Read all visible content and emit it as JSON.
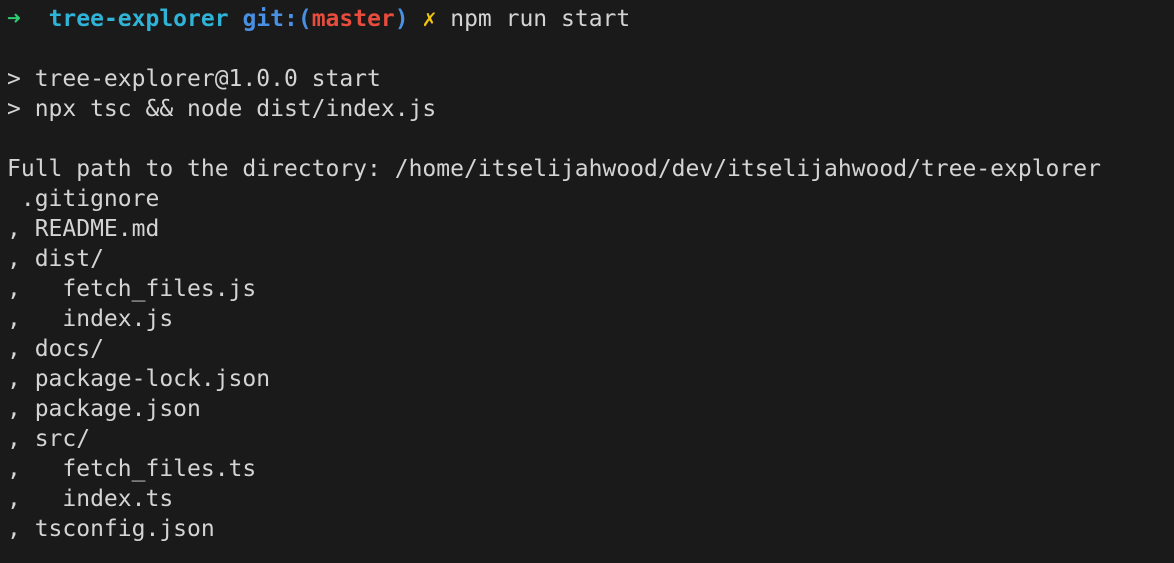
{
  "prompt": {
    "arrow": "➜",
    "directory": "tree-explorer",
    "git_prefix": "git:(",
    "branch": "master",
    "git_suffix": ")",
    "dirty_marker": "✗",
    "command": "npm run start"
  },
  "npm_output": [
    "> tree-explorer@1.0.0 start",
    "> npx tsc && node dist/index.js"
  ],
  "program_output": [
    "Full path to the directory: /home/itselijahwood/dev/itselijahwood/tree-explorer",
    " .gitignore",
    ", README.md",
    ", dist/",
    ",   fetch_files.js",
    ",   index.js",
    ", docs/",
    ", package-lock.json",
    ", package.json",
    ", src/",
    ",   fetch_files.ts",
    ",   index.ts",
    ", tsconfig.json"
  ],
  "colors": {
    "background": "#1a1a1a",
    "foreground": "#d4d4d4",
    "arrow": "#2ecc71",
    "directory": "#2fb3d6",
    "git": "#4a90e2",
    "branch": "#e74c3c",
    "dirty": "#f1c40f"
  }
}
